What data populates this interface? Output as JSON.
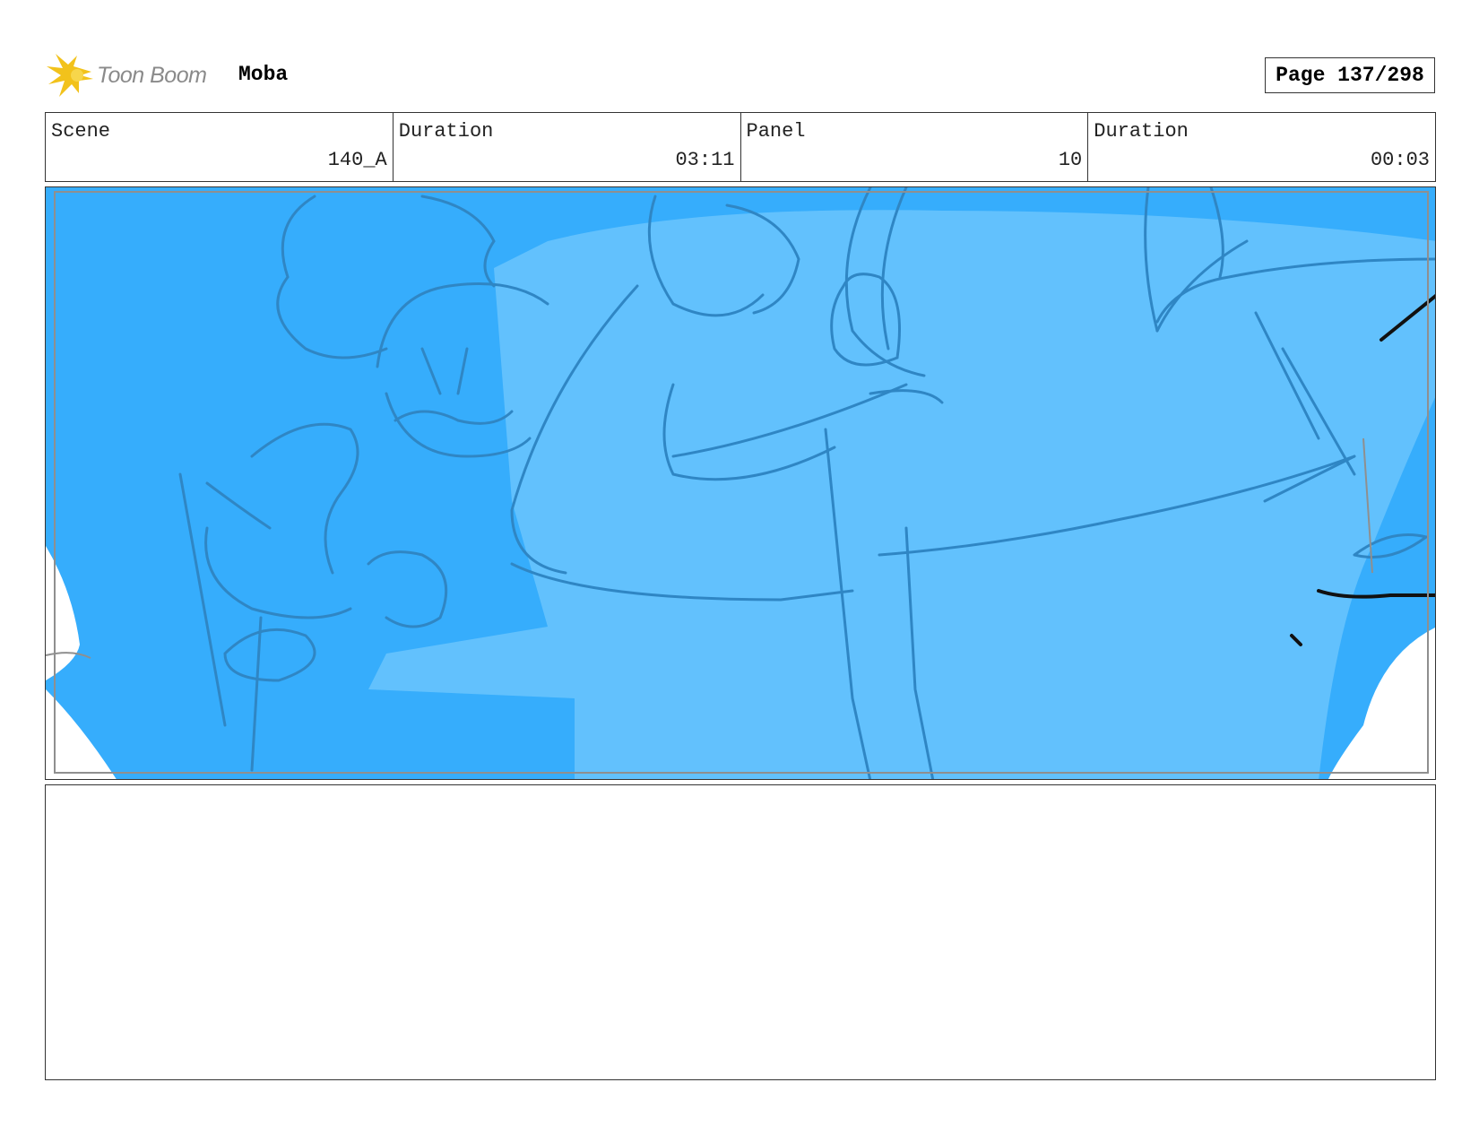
{
  "header": {
    "logo_text": "Toon Boom",
    "logo_icon": "toon-boom-starburst-icon",
    "project_title": "Moba",
    "page_label": "Page 137/298"
  },
  "info": {
    "scene_label": "Scene",
    "scene_value": "140_A",
    "scene_duration_label": "Duration",
    "scene_duration_value": "03:11",
    "panel_label": "Panel",
    "panel_value": "10",
    "panel_duration_label": "Duration",
    "panel_duration_value": "00:03"
  },
  "panel": {
    "image": "storyboard-sketch",
    "colors": {
      "dark_fill": "#36adfc",
      "light_fill": "#62c1fd",
      "line": "#2f86c4"
    }
  },
  "notes": {}
}
